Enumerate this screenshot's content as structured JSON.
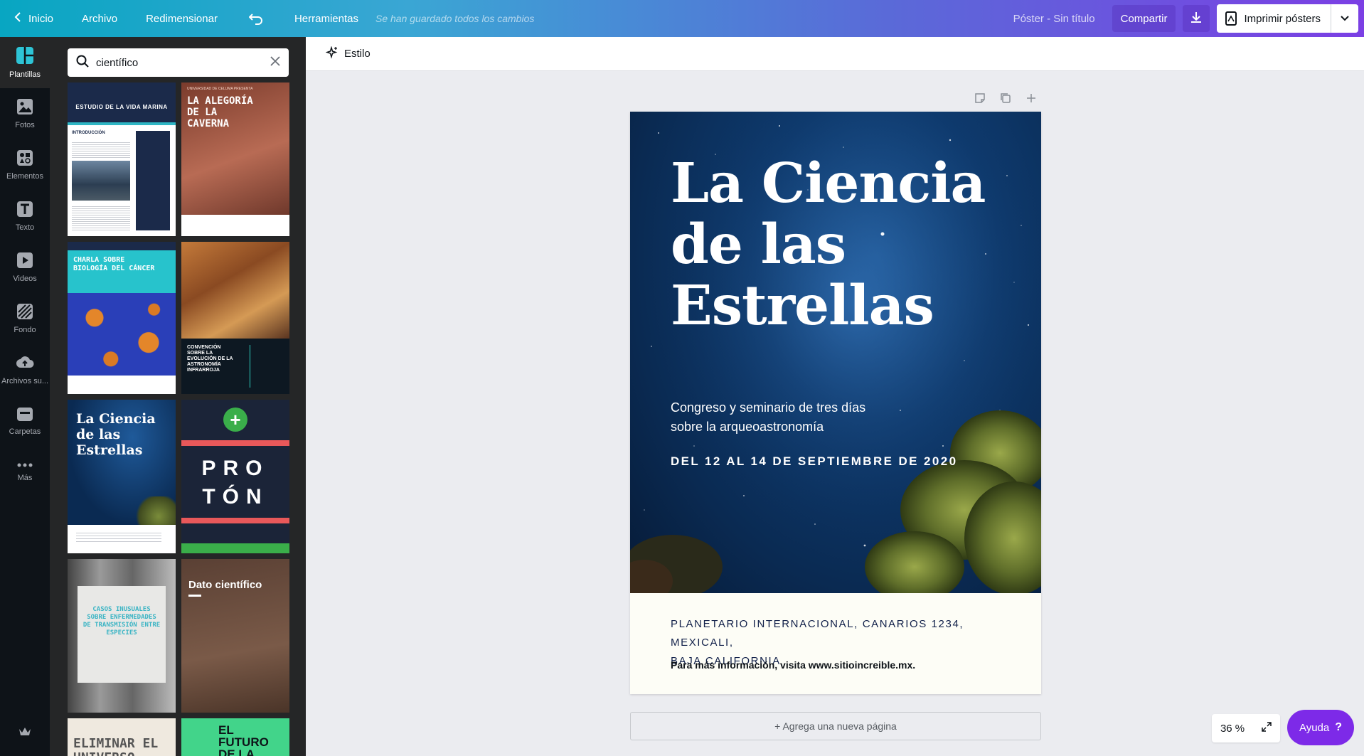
{
  "topbar": {
    "home": "Inicio",
    "file": "Archivo",
    "resize": "Redimensionar",
    "tools": "Herramientas",
    "saved_status": "Se han guardado todos los cambios",
    "doc_title": "Póster - Sin título",
    "share": "Compartir",
    "print": "Imprimir pósters"
  },
  "rail": {
    "items": [
      {
        "label": "Plantillas",
        "icon": "templates-icon"
      },
      {
        "label": "Fotos",
        "icon": "photos-icon"
      },
      {
        "label": "Elementos",
        "icon": "elements-icon"
      },
      {
        "label": "Texto",
        "icon": "text-icon"
      },
      {
        "label": "Videos",
        "icon": "video-icon"
      },
      {
        "label": "Fondo",
        "icon": "background-icon"
      },
      {
        "label": "Archivos su...",
        "icon": "uploads-icon"
      },
      {
        "label": "Carpetas",
        "icon": "folder-icon"
      },
      {
        "label": "Más",
        "icon": "more-icon"
      }
    ]
  },
  "search": {
    "value": "científico"
  },
  "templates": [
    {
      "t1": "ESTUDIO DE LA VIDA MARINA",
      "t2": "INTRODUCCIÓN"
    },
    {
      "t1": "LA ALEGORÍA DE LA CAVERNA",
      "t2": "UNIVERSIDAD DE CELUMA PRESENTA"
    },
    {
      "t1": "CHARLA SOBRE BIOLOGÍA DEL CÁNCER"
    },
    {
      "t1": "CONVENCIÓN SOBRE LA EVOLUCIÓN DE LA ASTRONOMÍA INFRARROJA"
    },
    {
      "t1": "La Ciencia de las Estrellas"
    },
    {
      "t1": "PRO",
      "t2": "TÓN"
    },
    {
      "t1": "CASOS INUSUALES SOBRE ENFERMEDADES DE TRANSMISIÓN ENTRE ESPECIES"
    },
    {
      "t1": "Dato científico"
    },
    {
      "t1": "ELIMINAR EL UNIVERSO"
    },
    {
      "t1": "EL FUTURO DE LA TERAPIA"
    }
  ],
  "editor": {
    "style_button": "Estilo",
    "add_page": "+ Agrega una nueva página",
    "zoom": "36 %",
    "help": "Ayuda"
  },
  "poster": {
    "title_lines": [
      "La Ciencia",
      "de las",
      "Estrellas"
    ],
    "subtitle_lines": [
      "Congreso y seminario de tres días",
      "sobre la arqueoastronomía"
    ],
    "date": "DEL 12 AL 14 DE SEPTIEMBRE DE 2020",
    "address_lines": [
      "PLANETARIO INTERNACIONAL, CANARIOS 1234, MEXICALI,",
      "BAJA CALIFORNIA"
    ],
    "info": "Para más información, visita www.sitioincreible.mx."
  },
  "colors": {
    "accent": "#7d2ae8",
    "rail_bg": "#0e1318",
    "panel_bg": "#252627",
    "canvas_bg": "#ebecf0"
  }
}
